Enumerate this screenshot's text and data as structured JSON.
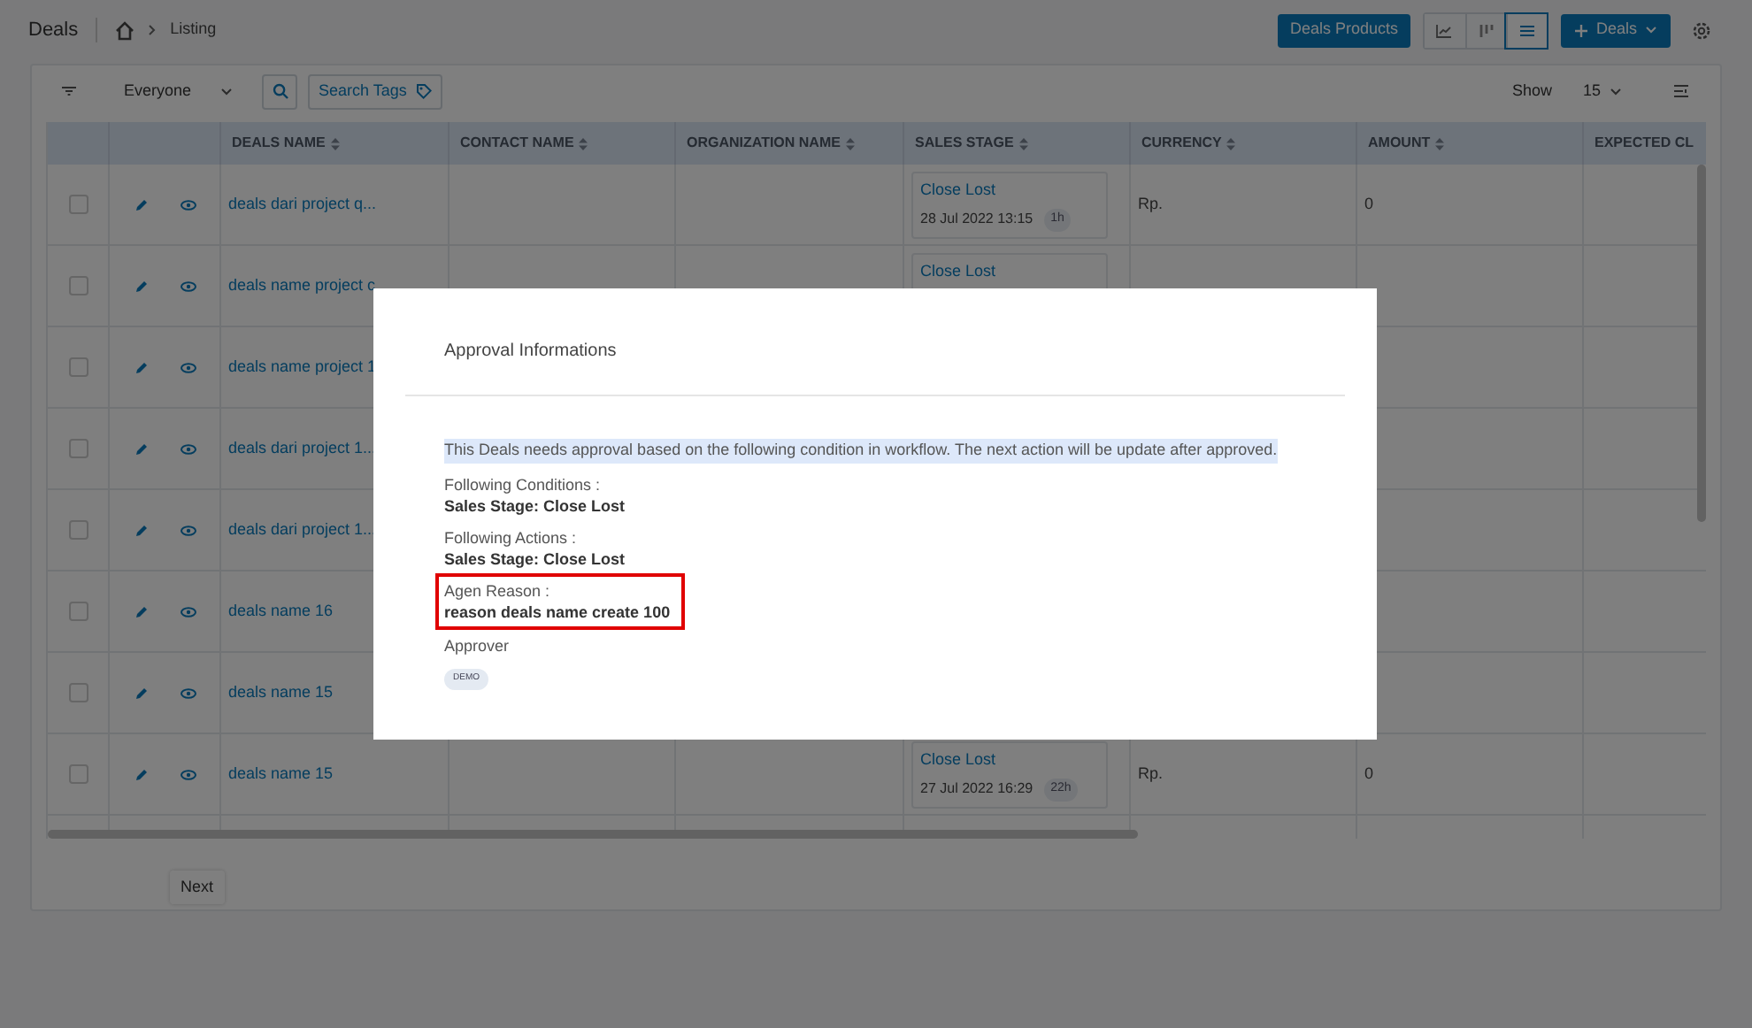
{
  "header": {
    "title": "Deals",
    "breadcrumb": "Listing",
    "products_button": "Deals Products",
    "add_button": "Deals",
    "views": [
      {
        "kind": "chart",
        "selected": false
      },
      {
        "kind": "kanban",
        "selected": false
      },
      {
        "kind": "list",
        "selected": true
      }
    ]
  },
  "toolbar": {
    "owner": "Everyone",
    "search_tags": "Search Tags",
    "show_label": "Show",
    "page_size": "15"
  },
  "table": {
    "columns": [
      "DEALS NAME",
      "CONTACT NAME",
      "ORGANIZATION NAME",
      "SALES STAGE",
      "CURRENCY",
      "AMOUNT",
      "EXPECTED CL"
    ],
    "rows": [
      {
        "checked": false,
        "deal_name": "deals dari project q...",
        "stage": "Close Lost",
        "stage_date": "28 Jul 2022 13:15",
        "stage_age": "1h",
        "currency": "Rp.",
        "amount": "0"
      },
      {
        "checked": false,
        "deal_name": "deals name project c",
        "stage": "Close Lost"
      },
      {
        "checked": false,
        "deal_name": "deals name project 1"
      },
      {
        "checked": false,
        "deal_name": "deals dari project 1..."
      },
      {
        "checked": false,
        "deal_name": "deals dari project 1..."
      },
      {
        "checked": false,
        "deal_name": "deals name 16"
      },
      {
        "checked": false,
        "deal_name": "deals name 15"
      },
      {
        "checked": false,
        "deal_name": "deals name 15",
        "stage": "Close Lost",
        "stage_date": "27 Jul 2022 16:29",
        "stage_age": "22h",
        "currency": "Rp.",
        "amount": "0"
      }
    ]
  },
  "pagination": {
    "next": "Next"
  },
  "modal": {
    "title": "Approval Informations",
    "notice": "This Deals needs approval based on the following condition in workflow. The next action will be update after approved.",
    "sections": [
      {
        "label": "Following Conditions :",
        "value": "Sales Stage: Close Lost",
        "highlighted": false
      },
      {
        "label": "Following Actions :",
        "value": "Sales Stage: Close Lost",
        "highlighted": false
      },
      {
        "label": "Agen Reason :",
        "value": "reason deals name create 100",
        "highlighted": true
      }
    ],
    "approver_label": "Approver",
    "approvers": [
      "DEMO"
    ]
  }
}
